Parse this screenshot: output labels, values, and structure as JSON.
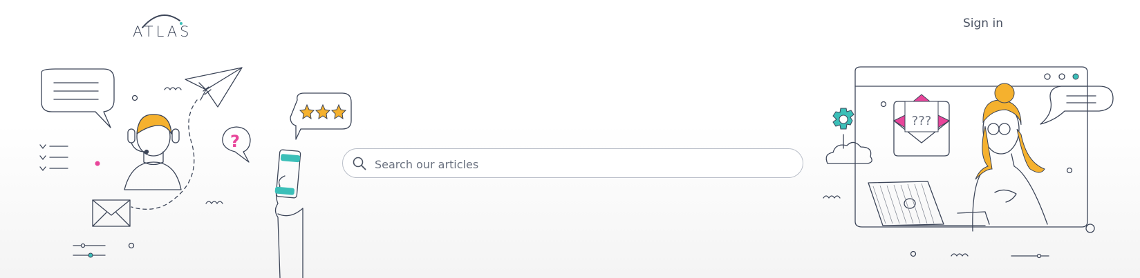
{
  "header": {
    "logo_text": "ATLAS",
    "signin_label": "Sign in"
  },
  "search": {
    "placeholder": "Search our articles",
    "value": ""
  },
  "illustrations": {
    "left_rating_stars": 3,
    "right_envelope_text": "???"
  },
  "colors": {
    "accent_orange": "#f5b12e",
    "accent_teal": "#3bbfb8",
    "accent_pink": "#e8459a",
    "line": "#3c4558"
  }
}
